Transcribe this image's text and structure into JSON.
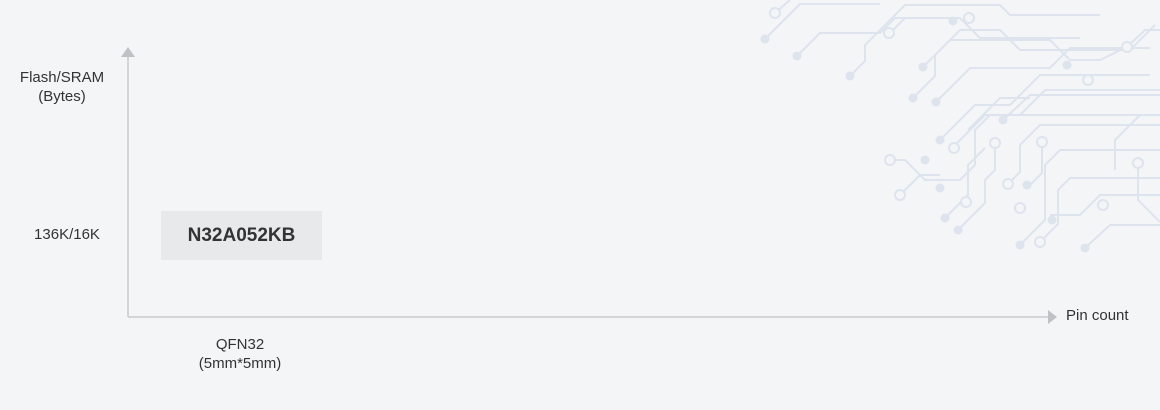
{
  "chart_data": {
    "type": "table",
    "title": "",
    "ylabel": "Flash/SRAM\n(Bytes)",
    "xlabel": "Pin count",
    "y_categories": [
      "136K/16K"
    ],
    "x_categories": [
      "QFN32\n(5mm*5mm)"
    ],
    "items": [
      {
        "name": "N32A052KB",
        "x": "QFN32\n(5mm*5mm)",
        "y": "136K/16K"
      }
    ]
  },
  "colors": {
    "background": "#f4f5f7",
    "axis": "#c7c9cc",
    "chip": "#e8e9eb",
    "decoration": "#dde4ee"
  }
}
